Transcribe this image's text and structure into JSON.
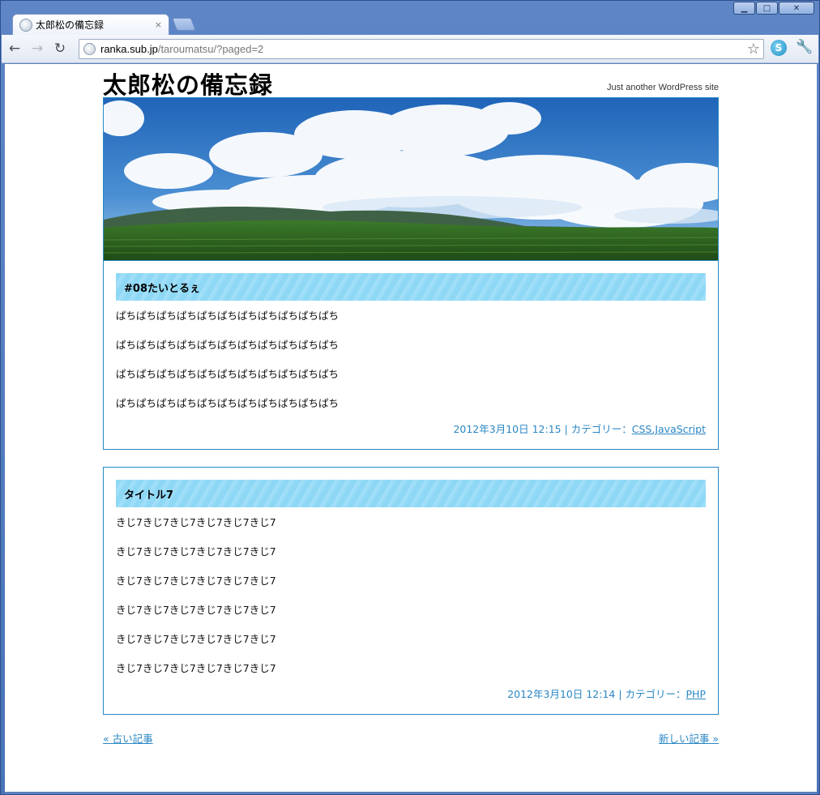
{
  "browser": {
    "tab_title": "太郎松の備忘録",
    "tab_close": "×",
    "url_host": "ranka.sub.jp",
    "url_path": "/taroumatsu/?paged=2",
    "back_icon": "←",
    "forward_icon": "→",
    "reload_icon": "↻",
    "star_icon": "☆",
    "wrench_icon": "🔧",
    "ext_icon": "S",
    "win_min": "▁",
    "win_max": "□",
    "win_close": "✕"
  },
  "site": {
    "title": "太郎松の備忘録",
    "description": "Just another WordPress site"
  },
  "posts": [
    {
      "title": "#08たいとるぇ",
      "paragraphs": [
        "ぱちぱちぱちぱちぱちぱちぱちぱちぱちぱちぱち",
        "ぱちぱちぱちぱちぱちぱちぱちぱちぱちぱちぱち",
        "ぱちぱちぱちぱちぱちぱちぱちぱちぱちぱちぱち",
        "ぱちぱちぱちぱちぱちぱちぱちぱちぱちぱちぱち"
      ],
      "meta_prefix": "2012年3月10日 12:15 | カテゴリー：",
      "categories": "CSS,JavaScript"
    },
    {
      "title": "タイトル7",
      "paragraphs": [
        "きじ7きじ7きじ7きじ7きじ7きじ7",
        "きじ7きじ7きじ7きじ7きじ7きじ7",
        "きじ7きじ7きじ7きじ7きじ7きじ7",
        "きじ7きじ7きじ7きじ7きじ7きじ7",
        "きじ7きじ7きじ7きじ7きじ7きじ7",
        "きじ7きじ7きじ7きじ7きじ7きじ7"
      ],
      "meta_prefix": "2012年3月10日 12:14 | カテゴリー：",
      "categories": "PHP"
    }
  ],
  "pager": {
    "older": "« 古い記事",
    "newer": "新しい記事 »"
  },
  "colors": {
    "accent": "#2a87c5",
    "title_bar": "#8ed8f6"
  }
}
